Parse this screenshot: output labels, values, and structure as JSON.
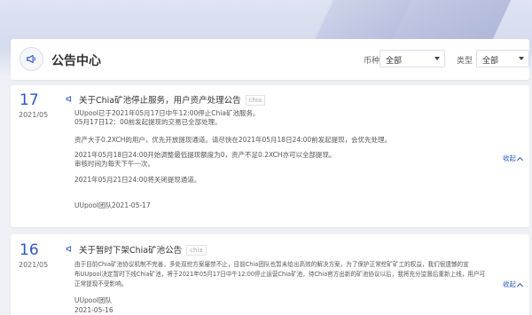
{
  "header": {
    "title": "公告中心",
    "currency_label": "币种",
    "currency_value": "全部",
    "type_label": "类型",
    "type_value": "全部"
  },
  "notices": [
    {
      "day": "17",
      "year_month": "2021/05",
      "title": "关于Chia矿池停止服务，用户资产处理公告",
      "tag": "chia",
      "lines": [
        "UUpool已于2021年05月17日中午12:00停止Chia矿池服务。",
        "05月17日12：00前发起提现的交易已全部处理。",
        "资产大于0.2XCH的用户，优先开放提现通道。请尽快在2021年05月18日24:00前发起提现，会优先处理。",
        "2021年05月18日24:00开始调整最低提现额度为0，资产不足0.2XCH亦可以全部提现。",
        "审核时间为每天下午一次。",
        "2021年05月21日24:00将关闭提现通道。",
        "UUpool团队2021-05-17"
      ],
      "collapse": "收起"
    },
    {
      "day": "16",
      "year_month": "2021/05",
      "title": "关于暂时下架Chia矿池公告",
      "tag": "chia",
      "lines": [
        "由于目前Chia矿池协议机制不完善，多处双挖方案屡禁不止，目前Chia团队也暂未给出高效的解决方案，为了保护正常挖矿矿工的权益，我们很遗憾的宣",
        "布UUpool决定暂时下线Chia矿池，将于2021年05月17日中午12:00停止运营Chia矿池，待Chia官方出新的矿池协议以后，我将充分监督后重新上线，用户可",
        "正常提现不受影响。",
        "UUpool团队",
        "2021-05-16"
      ],
      "collapse": "收起"
    }
  ]
}
